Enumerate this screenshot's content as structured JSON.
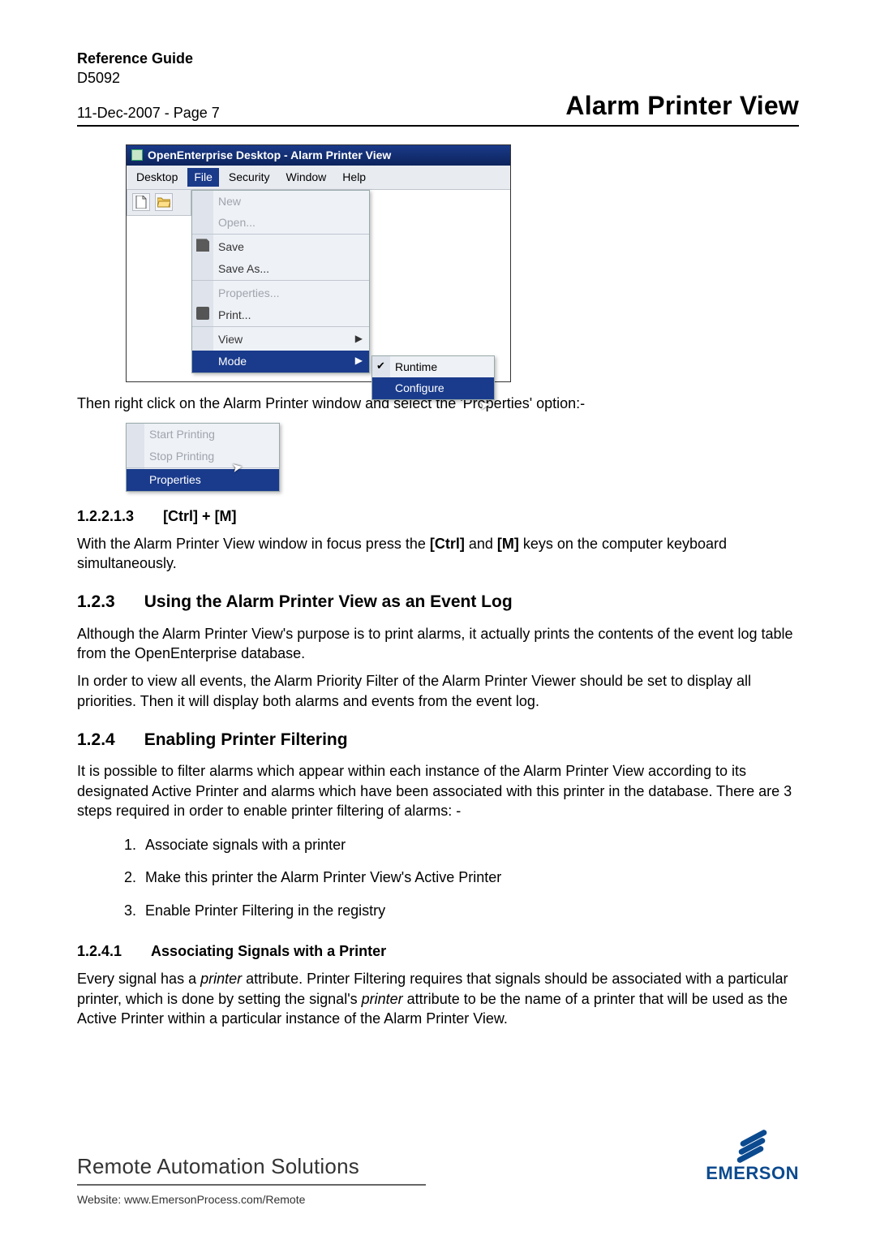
{
  "header": {
    "title_bold": "Reference Guide",
    "doc_id": "D5092",
    "dateline": "11-Dec-2007 - Page 7",
    "right_title": "Alarm Printer View"
  },
  "shot1": {
    "title": "OpenEnterprise Desktop - Alarm Printer View",
    "menus": {
      "desktop": "Desktop",
      "file": "File",
      "security": "Security",
      "window": "Window",
      "help": "Help"
    },
    "items": {
      "new": "New",
      "open": "Open...",
      "save": "Save",
      "saveas": "Save As...",
      "properties": "Properties...",
      "print": "Print...",
      "view": "View",
      "mode": "Mode"
    },
    "submenu": {
      "runtime": "Runtime",
      "configure": "Configure"
    }
  },
  "para_after_shot1": "Then right click on the Alarm Printer window and select the 'Properties' option:-",
  "shot2": {
    "start": "Start Printing",
    "stop": "Stop Printing",
    "properties": "Properties"
  },
  "sec12213": {
    "num": "1.2.2.1.3",
    "title": "[Ctrl] + [M]",
    "body_a": "With the Alarm Printer View window in focus press the ",
    "ctrl": "[Ctrl]",
    "and": " and ",
    "m": "[M]",
    "body_b": " keys on the computer keyboard simultaneously."
  },
  "sec123": {
    "num": "1.2.3",
    "title": "Using the Alarm Printer View as an Event Log",
    "p1": "Although the Alarm Printer View's purpose is to print alarms, it actually prints the contents of the event log table from the OpenEnterprise database.",
    "p2": "In order to view all events, the Alarm Priority Filter of the Alarm Printer Viewer should be set to display all priorities.  Then it will display both alarms and events from the event log."
  },
  "sec124": {
    "num": "1.2.4",
    "title": "Enabling Printer Filtering",
    "p1": "It is possible to filter alarms which appear within each instance of the Alarm Printer View according to its designated Active Printer and alarms which have been associated with this printer in the database. There are 3 steps required in order to enable printer filtering of alarms: -",
    "steps": [
      "Associate signals with a printer",
      "Make this printer the Alarm Printer View's Active Printer",
      "Enable Printer Filtering in the registry"
    ]
  },
  "sec1241": {
    "num": "1.2.4.1",
    "title": "Associating Signals with a Printer",
    "body_a": "Every signal has a ",
    "printer1": "printer",
    "body_b": " attribute. Printer Filtering requires that signals should be associated with a particular printer, which is done by setting the signal's ",
    "printer2": "printer",
    "body_c": " attribute to be the name of a printer that will be used as the Active Printer within a particular instance of the Alarm Printer View."
  },
  "footer": {
    "ras": "Remote Automation Solutions",
    "logo": "EMERSON",
    "website": "Website:  www.EmersonProcess.com/Remote"
  }
}
